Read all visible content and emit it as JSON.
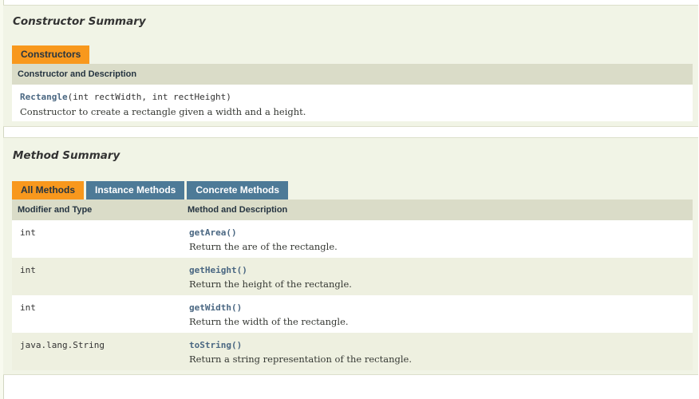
{
  "constructor_summary": {
    "title": "Constructor Summary",
    "tab": "Constructors",
    "header": "Constructor and Description",
    "rows": [
      {
        "name": "Rectangle",
        "params": "(int rectWidth, int rectHeight)",
        "description": "Constructor to create a rectangle given a width and a height."
      }
    ]
  },
  "method_summary": {
    "title": "Method Summary",
    "tabs": [
      {
        "label": "All Methods",
        "active": true
      },
      {
        "label": "Instance Methods",
        "active": false
      },
      {
        "label": "Concrete Methods",
        "active": false
      }
    ],
    "header_type": "Modifier and Type",
    "header_method": "Method and Description",
    "rows": [
      {
        "type": "int",
        "name": "getArea",
        "params": "()",
        "description": "Return the are of the rectangle."
      },
      {
        "type": "int",
        "name": "getHeight",
        "params": "()",
        "description": "Return the height of the rectangle."
      },
      {
        "type": "int",
        "name": "getWidth",
        "params": "()",
        "description": "Return the width of the rectangle."
      },
      {
        "type": "java.lang.String",
        "name": "toString",
        "params": "()",
        "description": "Return a string representation of the rectangle."
      }
    ]
  },
  "colors": {
    "tab_active": "#f8981d",
    "tab_inactive": "#4d7a97",
    "link": "#4a6782",
    "section_bg": "#f1f4e6"
  }
}
